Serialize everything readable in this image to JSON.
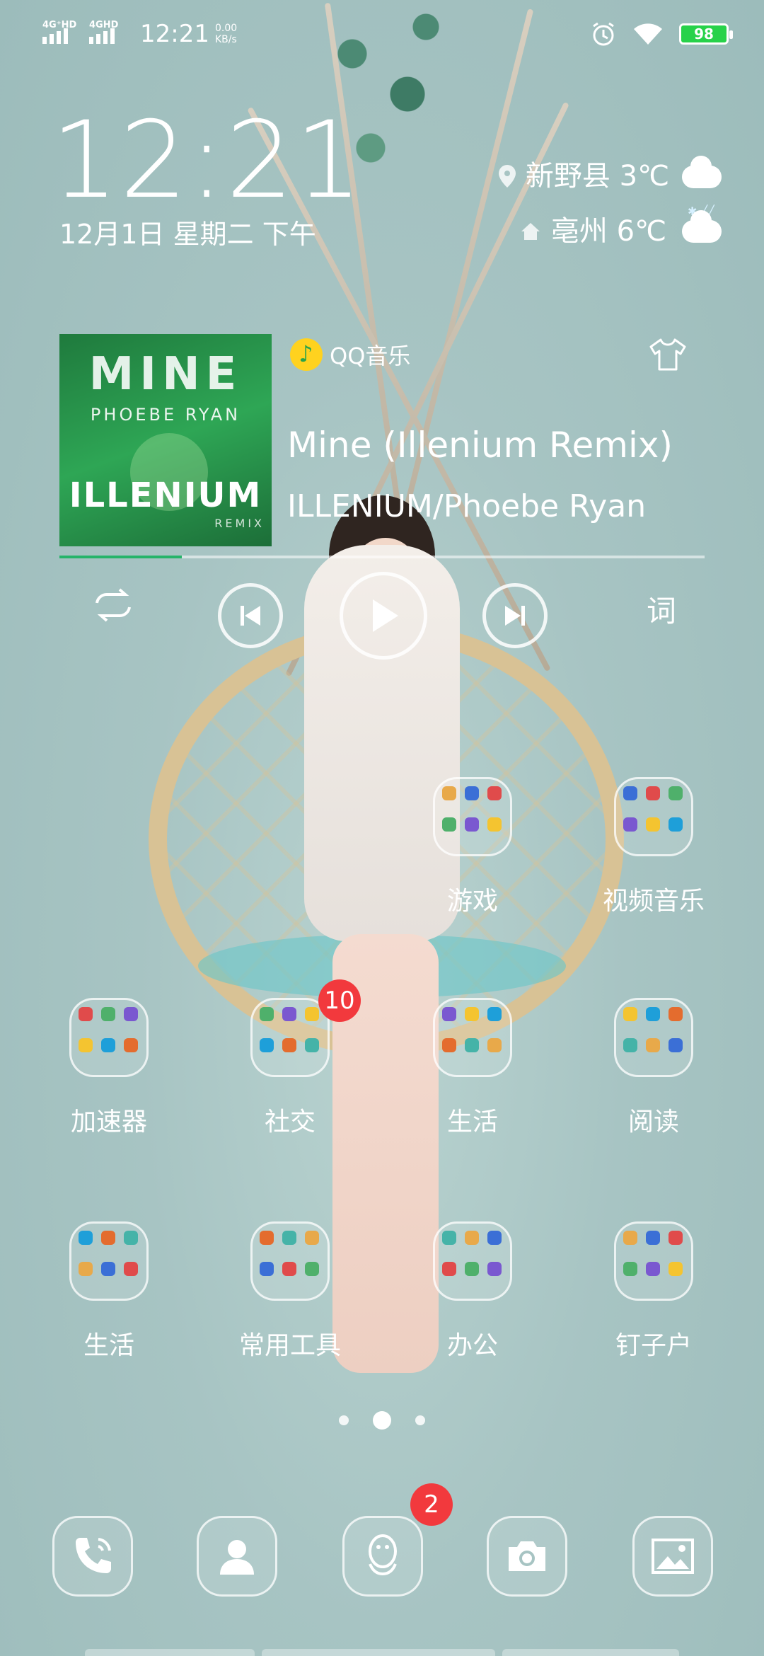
{
  "status_bar": {
    "sim1": "4G⁺HD",
    "sim2": "4GHD",
    "time": "12:21",
    "speed_value": "0.00",
    "speed_unit": "KB/s",
    "battery": "98",
    "icons": [
      "alarm-icon",
      "wifi-icon",
      "battery-icon"
    ]
  },
  "clock_widget": {
    "time": "12:21",
    "date": "12月1日 星期二 下午"
  },
  "weather": [
    {
      "place": "新野县 3℃",
      "icon": "location-pin-icon",
      "condition_icon": "sleet-cloud-icon"
    },
    {
      "place": "亳州 6℃",
      "icon": "home-icon",
      "condition_icon": "cloud-icon"
    }
  ],
  "music": {
    "app": "QQ音乐",
    "title": "Mine (Illenium Remix)",
    "artist": "ILLENIUM/Phoebe Ryan",
    "album_art_text": {
      "line1": "MINE",
      "line2": "PHOEBE RYAN",
      "line3": "ILLENIUM",
      "line4": "REMIX"
    },
    "progress": 0.19,
    "lyrics_label": "词",
    "accent": "#25b469"
  },
  "folders": [
    {
      "label": "游戏"
    },
    {
      "label": "视频音乐"
    },
    {
      "label": "加速器"
    },
    {
      "label": "社交",
      "badge": "10"
    },
    {
      "label": "生活"
    },
    {
      "label": "阅读"
    },
    {
      "label": "生活"
    },
    {
      "label": "常用工具"
    },
    {
      "label": "办公"
    },
    {
      "label": "钉子户"
    }
  ],
  "dock": [
    {
      "name": "phone"
    },
    {
      "name": "contacts"
    },
    {
      "name": "qq",
      "badge": "2"
    },
    {
      "name": "camera"
    },
    {
      "name": "gallery"
    }
  ],
  "colors": {
    "badge": "#f2393d",
    "battery": "#27d24a"
  }
}
